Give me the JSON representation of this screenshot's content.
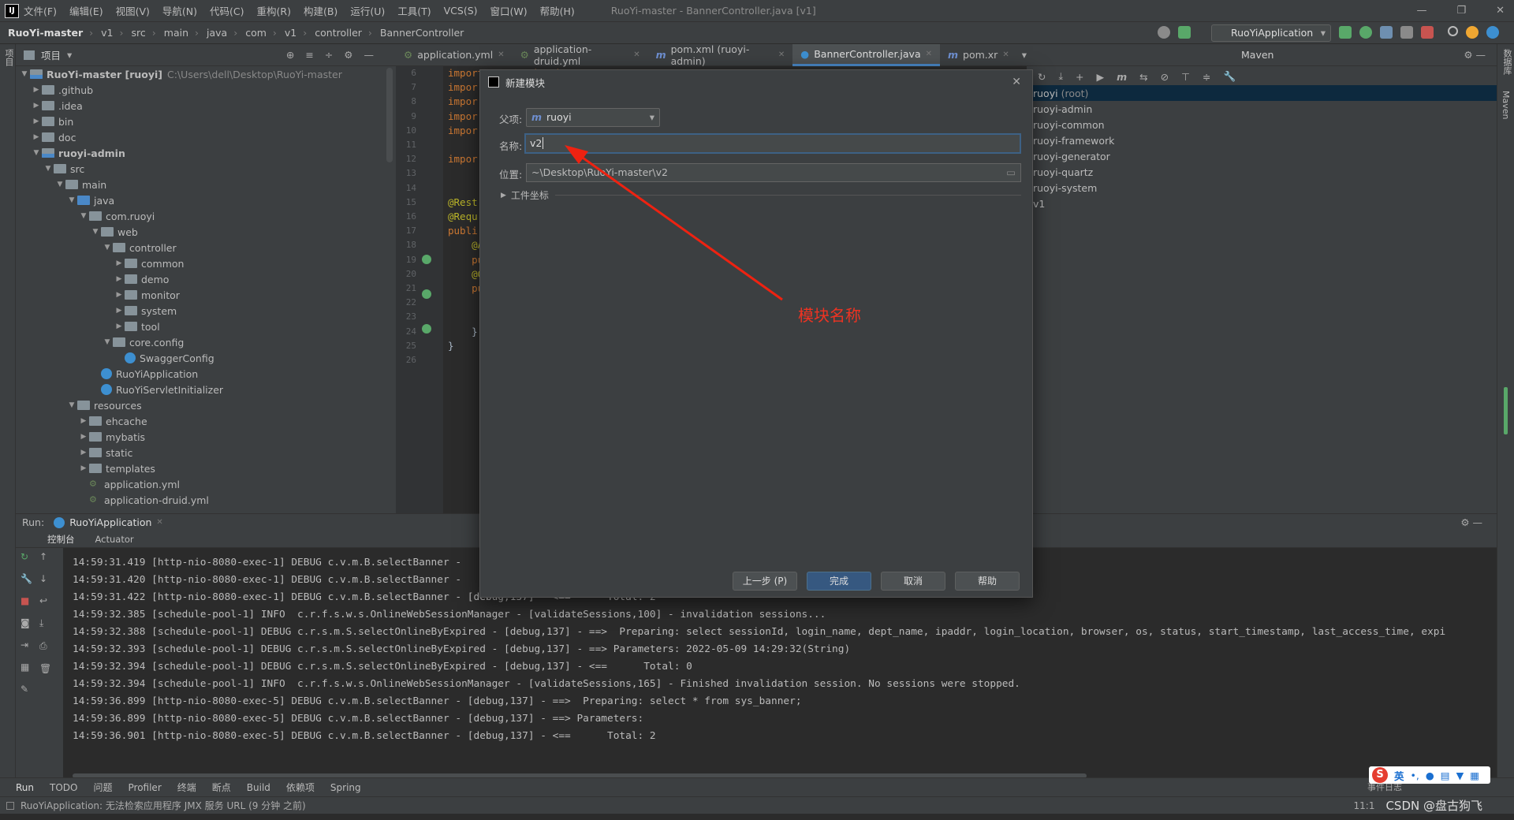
{
  "menubar": {
    "items": [
      "文件(F)",
      "编辑(E)",
      "视图(V)",
      "导航(N)",
      "代码(C)",
      "重构(R)",
      "构建(B)",
      "运行(U)",
      "工具(T)",
      "VCS(S)",
      "窗口(W)",
      "帮助(H)"
    ],
    "window_title": "RuoYi-master - BannerController.java [v1]"
  },
  "breadcrumb": [
    "RuoYi-master",
    "v1",
    "src",
    "main",
    "java",
    "com",
    "v1",
    "controller",
    "BannerController"
  ],
  "run_config": "RuoYiApplication",
  "project_panel": {
    "title": "项目",
    "tree": [
      {
        "label": "RuoYi-master [ruoyi]",
        "path": "C:\\Users\\dell\\Desktop\\RuoYi-master",
        "depth": 0,
        "arrow": "v",
        "kind": "module"
      },
      {
        "label": ".github",
        "depth": 1,
        "arrow": ">",
        "kind": "folder"
      },
      {
        "label": ".idea",
        "depth": 1,
        "arrow": ">",
        "kind": "folder"
      },
      {
        "label": "bin",
        "depth": 1,
        "arrow": ">",
        "kind": "folder"
      },
      {
        "label": "doc",
        "depth": 1,
        "arrow": ">",
        "kind": "folder"
      },
      {
        "label": "ruoyi-admin",
        "depth": 1,
        "arrow": "v",
        "kind": "module"
      },
      {
        "label": "src",
        "depth": 2,
        "arrow": "v",
        "kind": "folder"
      },
      {
        "label": "main",
        "depth": 3,
        "arrow": "v",
        "kind": "folder"
      },
      {
        "label": "java",
        "depth": 4,
        "arrow": "v",
        "kind": "srcfolder"
      },
      {
        "label": "com.ruoyi",
        "depth": 5,
        "arrow": "v",
        "kind": "folder"
      },
      {
        "label": "web",
        "depth": 6,
        "arrow": "v",
        "kind": "folder"
      },
      {
        "label": "controller",
        "depth": 7,
        "arrow": "v",
        "kind": "folder"
      },
      {
        "label": "common",
        "depth": 8,
        "arrow": ">",
        "kind": "folder"
      },
      {
        "label": "demo",
        "depth": 8,
        "arrow": ">",
        "kind": "folder"
      },
      {
        "label": "monitor",
        "depth": 8,
        "arrow": ">",
        "kind": "folder"
      },
      {
        "label": "system",
        "depth": 8,
        "arrow": ">",
        "kind": "folder"
      },
      {
        "label": "tool",
        "depth": 8,
        "arrow": ">",
        "kind": "folder"
      },
      {
        "label": "core.config",
        "depth": 7,
        "arrow": "v",
        "kind": "folder"
      },
      {
        "label": "SwaggerConfig",
        "depth": 8,
        "arrow": "",
        "kind": "class"
      },
      {
        "label": "RuoYiApplication",
        "depth": 6,
        "arrow": "",
        "kind": "class"
      },
      {
        "label": "RuoYiServletInitializer",
        "depth": 6,
        "arrow": "",
        "kind": "class"
      },
      {
        "label": "resources",
        "depth": 4,
        "arrow": "v",
        "kind": "folder"
      },
      {
        "label": "ehcache",
        "depth": 5,
        "arrow": ">",
        "kind": "folder"
      },
      {
        "label": "mybatis",
        "depth": 5,
        "arrow": ">",
        "kind": "folder"
      },
      {
        "label": "static",
        "depth": 5,
        "arrow": ">",
        "kind": "folder"
      },
      {
        "label": "templates",
        "depth": 5,
        "arrow": ">",
        "kind": "folder"
      },
      {
        "label": "application.yml",
        "depth": 5,
        "arrow": "",
        "kind": "yml"
      },
      {
        "label": "application-druid.yml",
        "depth": 5,
        "arrow": "",
        "kind": "yml"
      }
    ]
  },
  "editor": {
    "tabs": [
      {
        "label": "application.yml",
        "active": false
      },
      {
        "label": "application-druid.yml",
        "active": false
      },
      {
        "label": "pom.xml (ruoyi-admin)",
        "active": false
      },
      {
        "label": "BannerController.java",
        "active": true
      },
      {
        "label": "pom.xr",
        "active": false
      }
    ],
    "line_numbers": [
      "6",
      "7",
      "8",
      "9",
      "10",
      "11",
      "12",
      "13",
      "14",
      "15",
      "16",
      "17",
      "18",
      "19",
      "20",
      "21",
      "22",
      "23",
      "24",
      "25",
      "26"
    ],
    "code_lines": [
      {
        "line": "6",
        "text": "import com.v1.domain.Banner;",
        "color": "#cc7832"
      },
      {
        "line": "7",
        "text": "impor",
        "color": "#cc7832"
      },
      {
        "line": "8",
        "text": "impor",
        "color": "#cc7832"
      },
      {
        "line": "9",
        "text": "impor",
        "color": "#cc7832"
      },
      {
        "line": "10",
        "text": "impor",
        "color": "#cc7832"
      },
      {
        "line": "12",
        "text": "impor",
        "color": "#cc7832"
      },
      {
        "line": "15",
        "text": "@Rest",
        "color": "#bbb529"
      },
      {
        "line": "16",
        "text": "@Requ",
        "color": "#bbb529"
      },
      {
        "line": "17",
        "text": "publi",
        "color": "#cc7832"
      },
      {
        "line": "18",
        "text": "    @A",
        "color": "#bbb529"
      },
      {
        "line": "19",
        "text": "    pu",
        "color": "#cc7832"
      },
      {
        "line": "20",
        "text": "    @G",
        "color": "#bbb529"
      },
      {
        "line": "21",
        "text": "    pu",
        "color": "#cc7832"
      },
      {
        "line": "24",
        "text": "    }",
        "color": "#a9b7c6"
      },
      {
        "line": "25",
        "text": "}",
        "color": "#a9b7c6"
      }
    ]
  },
  "maven_panel": {
    "title": "Maven",
    "items": [
      {
        "label": "ruoyi",
        "suffix": "(root)",
        "selected": true
      },
      {
        "label": "ruoyi-admin",
        "suffix": "",
        "selected": false
      },
      {
        "label": "ruoyi-common",
        "suffix": "",
        "selected": false
      },
      {
        "label": "ruoyi-framework",
        "suffix": "",
        "selected": false
      },
      {
        "label": "ruoyi-generator",
        "suffix": "",
        "selected": false
      },
      {
        "label": "ruoyi-quartz",
        "suffix": "",
        "selected": false
      },
      {
        "label": "ruoyi-system",
        "suffix": "",
        "selected": false
      },
      {
        "label": "v1",
        "suffix": "",
        "selected": false
      }
    ]
  },
  "run_panel": {
    "label": "Run:",
    "config_tab": "RuoYiApplication",
    "subtabs": [
      "控制台",
      "Actuator"
    ],
    "console_lines": [
      "14:59:31.419 [http-nio-8080-exec-1] DEBUG c.v.m.B.selectBanner - ",
      "14:59:31.420 [http-nio-8080-exec-1] DEBUG c.v.m.B.selectBanner - ",
      "14:59:31.422 [http-nio-8080-exec-1] DEBUG c.v.m.B.selectBanner - [debug,137] - <==      Total: 2",
      "14:59:32.385 [schedule-pool-1] INFO  c.r.f.s.w.s.OnlineWebSessionManager - [validateSessions,100] - invalidation sessions...",
      "14:59:32.388 [schedule-pool-1] DEBUG c.r.s.m.S.selectOnlineByExpired - [debug,137] - ==>  Preparing: select sessionId, login_name, dept_name, ipaddr, login_location, browser, os, status, start_timestamp, last_access_time, expi",
      "14:59:32.393 [schedule-pool-1] DEBUG c.r.s.m.S.selectOnlineByExpired - [debug,137] - ==> Parameters: 2022-05-09 14:29:32(String)",
      "14:59:32.394 [schedule-pool-1] DEBUG c.r.s.m.S.selectOnlineByExpired - [debug,137] - <==      Total: 0",
      "14:59:32.394 [schedule-pool-1] INFO  c.r.f.s.w.s.OnlineWebSessionManager - [validateSessions,165] - Finished invalidation session. No sessions were stopped.",
      "14:59:36.899 [http-nio-8080-exec-5] DEBUG c.v.m.B.selectBanner - [debug,137] - ==>  Preparing: select * from sys_banner;",
      "14:59:36.899 [http-nio-8080-exec-5] DEBUG c.v.m.B.selectBanner - [debug,137] - ==> Parameters: ",
      "14:59:36.901 [http-nio-8080-exec-5] DEBUG c.v.m.B.selectBanner - [debug,137] - <==      Total: 2"
    ]
  },
  "bottom_tools": [
    "Run",
    "TODO",
    "问题",
    "Profiler",
    "终端",
    "断点",
    "Build",
    "依赖项",
    "Spring"
  ],
  "status": {
    "message": "RuoYiApplication: 无法检索应用程序 JMX 服务 URL (9 分钟 之前)",
    "position": "11:1",
    "event_log": "事件日志",
    "watermark": "CSDN @盘古狗飞"
  },
  "dialog": {
    "title": "新建模块",
    "parent_label": "父项:",
    "parent_value": "ruoyi",
    "name_label": "名称:",
    "name_value": "v2",
    "location_label": "位置:",
    "location_value": "~\\Desktop\\RuoYi-master\\v2",
    "coordinates_label": "工件坐标",
    "buttons": {
      "prev": "上一步 (P)",
      "finish": "完成",
      "cancel": "取消",
      "help": "帮助"
    }
  },
  "annotation": {
    "text": "模块名称",
    "color": "#ee3322"
  },
  "left_strip_label": "项目",
  "right_strip_labels": [
    "数据库",
    "Maven"
  ],
  "ime_label": "英"
}
